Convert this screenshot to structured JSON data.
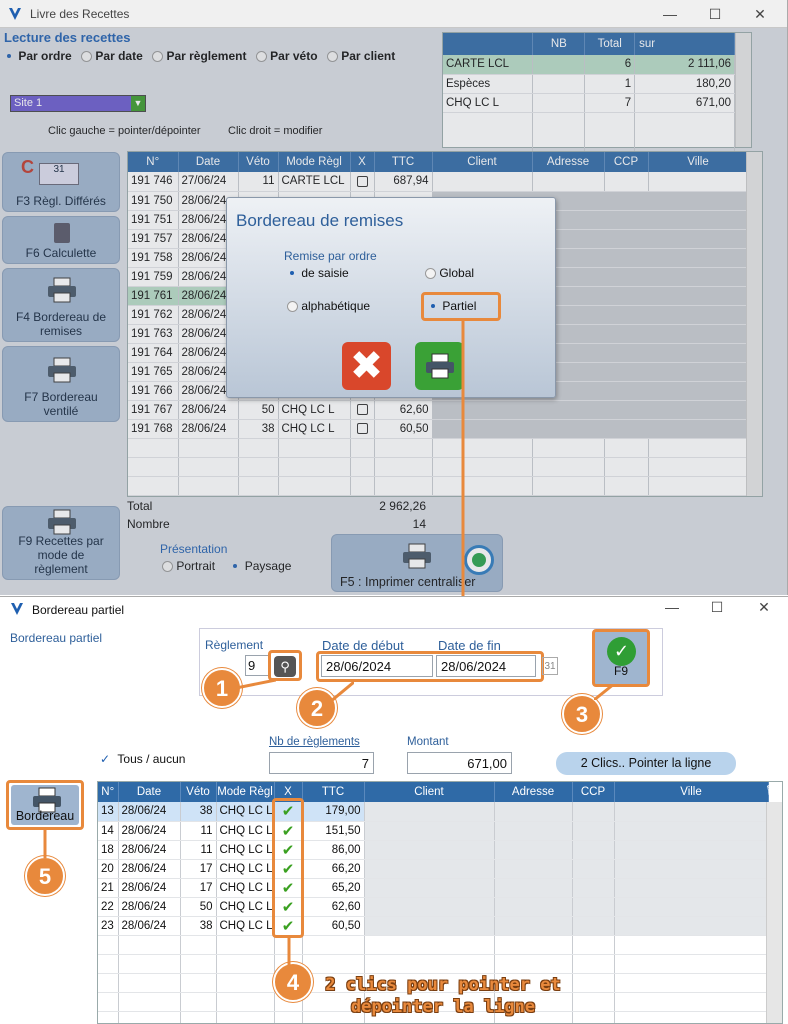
{
  "win1": {
    "title": "Livre des Recettes",
    "section_title": "Lecture des recettes",
    "sort_options": [
      {
        "label": "Par ordre",
        "checked": true
      },
      {
        "label": "Par date",
        "checked": false
      },
      {
        "label": "Par règlement",
        "checked": false
      },
      {
        "label": "Par véto",
        "checked": false
      },
      {
        "label": "Par client",
        "checked": false
      }
    ],
    "site": "Site 1",
    "hint_left": "Clic gauche = pointer/dépointer",
    "hint_right": "Clic droit = modifier",
    "summary": {
      "headers": [
        "",
        "NB",
        "Total",
        "sur"
      ],
      "rows": [
        {
          "name": "CARTE LCL",
          "count": "6",
          "total": "2 111,06"
        },
        {
          "name": "Espèces",
          "count": "1",
          "total": "180,20"
        },
        {
          "name": "CHQ  LC L",
          "count": "7",
          "total": "671,00"
        }
      ]
    },
    "side_buttons": {
      "f3": "F3 Règl. Différés",
      "f6": "F6 Calculette",
      "f4_line1": "F4 Bordereau de",
      "f4_line2": "remises",
      "f7_line1": "F7 Bordereau",
      "f7_line2": "ventilé",
      "f9_line1": "F9 Recettes par",
      "f9_line2": "mode de",
      "f9_line3": "règlement"
    },
    "table": {
      "headers": [
        "N°",
        "Date",
        "Véto",
        "Mode Règl",
        "X",
        "TTC",
        "Client",
        "Adresse",
        "CCP",
        "Ville"
      ],
      "rows": [
        {
          "n": "191 746",
          "date": "27/06/24",
          "veto": "11",
          "mode": "CARTE LCL",
          "ttc": "687,94"
        },
        {
          "n": "191 750",
          "date": "28/06/24",
          "veto": "",
          "mode": "",
          "ttc": ""
        },
        {
          "n": "191 751",
          "date": "28/06/24",
          "veto": "",
          "mode": "",
          "ttc": ""
        },
        {
          "n": "191 757",
          "date": "28/06/24",
          "veto": "",
          "mode": "",
          "ttc": ""
        },
        {
          "n": "191 758",
          "date": "28/06/24",
          "veto": "",
          "mode": "",
          "ttc": ""
        },
        {
          "n": "191 759",
          "date": "28/06/24",
          "veto": "",
          "mode": "",
          "ttc": ""
        },
        {
          "n": "191 761",
          "date": "28/06/24",
          "veto": "",
          "mode": "",
          "ttc": ""
        },
        {
          "n": "191 762",
          "date": "28/06/24",
          "veto": "",
          "mode": "",
          "ttc": ""
        },
        {
          "n": "191 763",
          "date": "28/06/24",
          "veto": "",
          "mode": "",
          "ttc": ""
        },
        {
          "n": "191 764",
          "date": "28/06/24",
          "veto": "",
          "mode": "",
          "ttc": ""
        },
        {
          "n": "191 765",
          "date": "28/06/24",
          "veto": "",
          "mode": "",
          "ttc": ""
        },
        {
          "n": "191 766",
          "date": "28/06/24",
          "veto": "",
          "mode": "",
          "ttc": ""
        },
        {
          "n": "191 767",
          "date": "28/06/24",
          "veto": "50",
          "mode": "CHQ  LC L",
          "ttc": "62,60"
        },
        {
          "n": "191 768",
          "date": "28/06/24",
          "veto": "38",
          "mode": "CHQ  LC L",
          "ttc": "60,50"
        }
      ],
      "total_label": "Total",
      "total_value": "2 962,26",
      "count_label": "Nombre",
      "count_value": "14"
    },
    "presentation": {
      "label": "Présentation",
      "portrait": "Portrait",
      "paysage": "Paysage"
    },
    "f5_label": "F5 : Imprimer centraliser"
  },
  "dialog": {
    "title": "Bordereau de remises",
    "group_label": "Remise par ordre",
    "opt_saisie": "de saisie",
    "opt_global": "Global",
    "opt_alpha": "alphabétique",
    "opt_partiel": "Partiel"
  },
  "win2": {
    "title": "Bordereau partiel",
    "subtitle": "Bordereau partiel",
    "reglement_label": "Règlement",
    "reglement_value": "9",
    "date_debut_label": "Date de début",
    "date_fin_label": "Date de fin",
    "date_debut": "28/06/2024",
    "date_fin": "28/06/2024",
    "f9": "F9",
    "tous_aucun": "Tous / aucun",
    "nb_label": "Nb de règlements",
    "nb_value": "7",
    "montant_label": "Montant",
    "montant_value": "671,00",
    "pointer_btn": "2 Clics.. Pointer la ligne",
    "bordereau_btn": "Bordereau",
    "table": {
      "headers": [
        "N°",
        "Date",
        "Véto",
        "Mode Règl",
        "X",
        "TTC",
        "Client",
        "Adresse",
        "CCP",
        "Ville"
      ],
      "rows": [
        {
          "n": "13",
          "date": "28/06/24",
          "veto": "38",
          "mode": "CHQ  LC L",
          "ttc": "179,00"
        },
        {
          "n": "14",
          "date": "28/06/24",
          "veto": "11",
          "mode": "CHQ  LC L",
          "ttc": "151,50"
        },
        {
          "n": "18",
          "date": "28/06/24",
          "veto": "11",
          "mode": "CHQ  LC L",
          "ttc": "86,00"
        },
        {
          "n": "20",
          "date": "28/06/24",
          "veto": "17",
          "mode": "CHQ  LC L",
          "ttc": "66,20"
        },
        {
          "n": "21",
          "date": "28/06/24",
          "veto": "17",
          "mode": "CHQ  LC L",
          "ttc": "65,20"
        },
        {
          "n": "22",
          "date": "28/06/24",
          "veto": "50",
          "mode": "CHQ  LC L",
          "ttc": "62,60"
        },
        {
          "n": "23",
          "date": "28/06/24",
          "veto": "38",
          "mode": "CHQ  LC L",
          "ttc": "60,50"
        }
      ]
    }
  },
  "annotations": {
    "b1": "1",
    "b2": "2",
    "b3": "3",
    "b4": "4",
    "b5": "5",
    "note_line1": "2 clics pour pointer et",
    "note_line2": "dépointer la ligne"
  },
  "colors": {
    "accent": "#e8893c",
    "header": "#2f6aa7",
    "highlight": "#b7dcc6"
  }
}
